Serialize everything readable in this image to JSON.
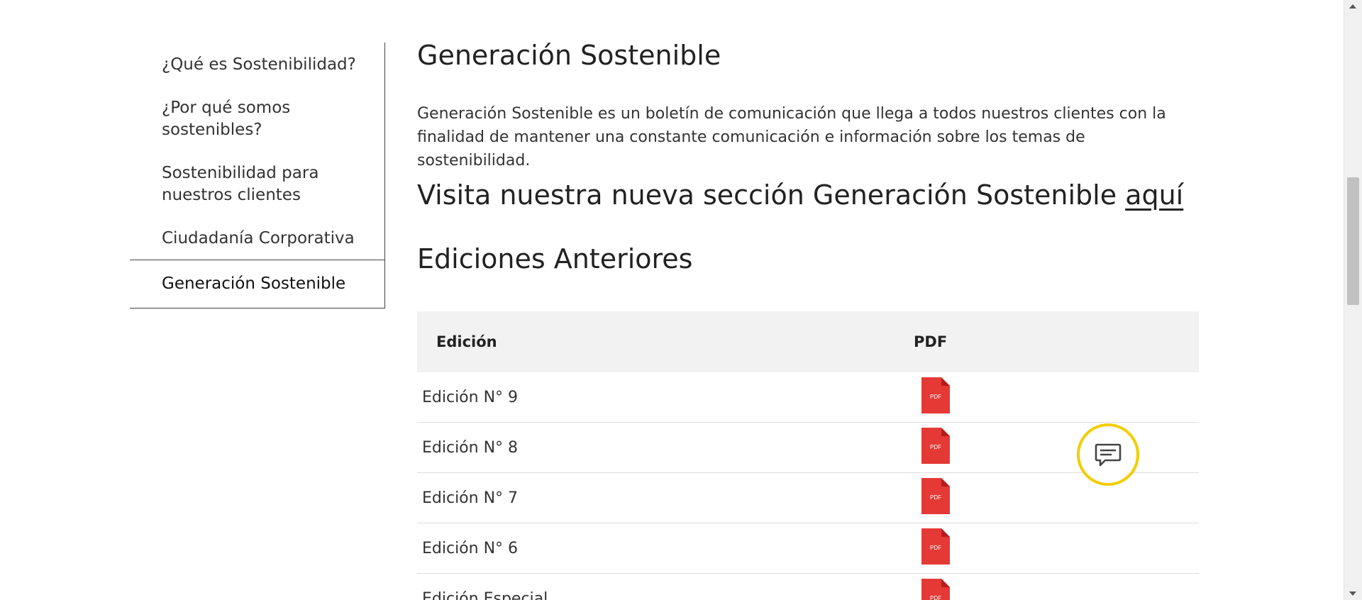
{
  "sidebar": {
    "items": [
      {
        "label": "¿Qué es Sostenibilidad?"
      },
      {
        "label": "¿Por qué somos sostenibles?"
      },
      {
        "label": "Sostenibilidad para nuestros clientes"
      },
      {
        "label": "Ciudadanía Corporativa"
      },
      {
        "label": "Generación Sostenible",
        "active": true
      }
    ]
  },
  "main": {
    "title": "Generación Sostenible",
    "intro": "Generación Sostenible es un boletín de comunicación que llega a todos nuestros clientes con la finalidad de mantener una constante comunicación e información sobre los temas de sostenibilidad.",
    "visit_text": "Visita nuestra nueva sección Generación Sostenible ",
    "visit_link": "aquí",
    "previous_title": "Ediciones Anteriores",
    "table": {
      "headers": {
        "edition": "Edición",
        "pdf": "PDF"
      },
      "rows": [
        {
          "name": "Edición N° 9",
          "pdf_label": "PDF"
        },
        {
          "name": "Edición N° 8",
          "pdf_label": "PDF"
        },
        {
          "name": "Edición N° 7",
          "pdf_label": "PDF"
        },
        {
          "name": "Edición N° 6",
          "pdf_label": "PDF"
        },
        {
          "name": "Edición Especial",
          "pdf_label": "PDF"
        }
      ]
    }
  },
  "icons": {
    "pdf": "pdf-file-icon",
    "chat": "chat-bubble-icon"
  },
  "colors": {
    "pdf_red": "#e53935",
    "chat_ring": "#f3cd00",
    "table_header_bg": "#f2f2f2"
  }
}
